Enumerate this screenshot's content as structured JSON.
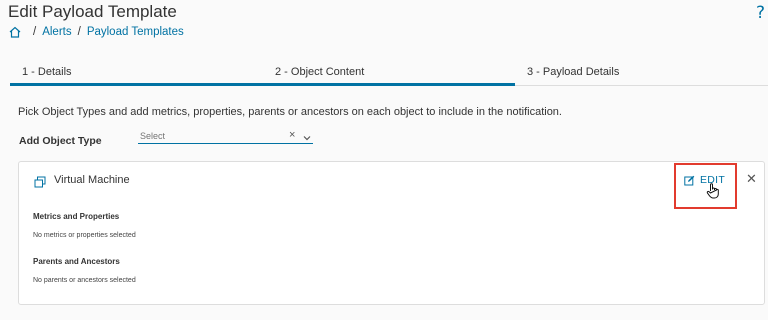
{
  "header": {
    "title": "Edit Payload Template"
  },
  "breadcrumb": {
    "items": [
      "Alerts",
      "Payload Templates"
    ],
    "separator": "/"
  },
  "tabs": [
    {
      "label": "1 - Details"
    },
    {
      "label": "2 - Object Content"
    },
    {
      "label": "3 - Payload Details"
    }
  ],
  "main": {
    "instructions": "Pick Object Types and add metrics, properties, parents or ancestors on each object to include in the notification.",
    "add_object_type_label": "Add Object Type",
    "select_placeholder": "Select"
  },
  "card": {
    "title": "Virtual Machine",
    "edit_label": "EDIT",
    "sections": [
      {
        "title": "Metrics and Properties",
        "empty_text": "No metrics or properties selected"
      },
      {
        "title": "Parents and Ancestors",
        "empty_text": "No parents or ancestors selected"
      }
    ]
  },
  "colors": {
    "accent": "#0072a3",
    "highlight": "#e23b2e"
  },
  "icons": [
    "home-icon",
    "help-icon",
    "clear-icon",
    "chevron-down-icon",
    "virtual-machine-icon",
    "edit-icon",
    "hand-cursor-icon",
    "close-icon"
  ]
}
